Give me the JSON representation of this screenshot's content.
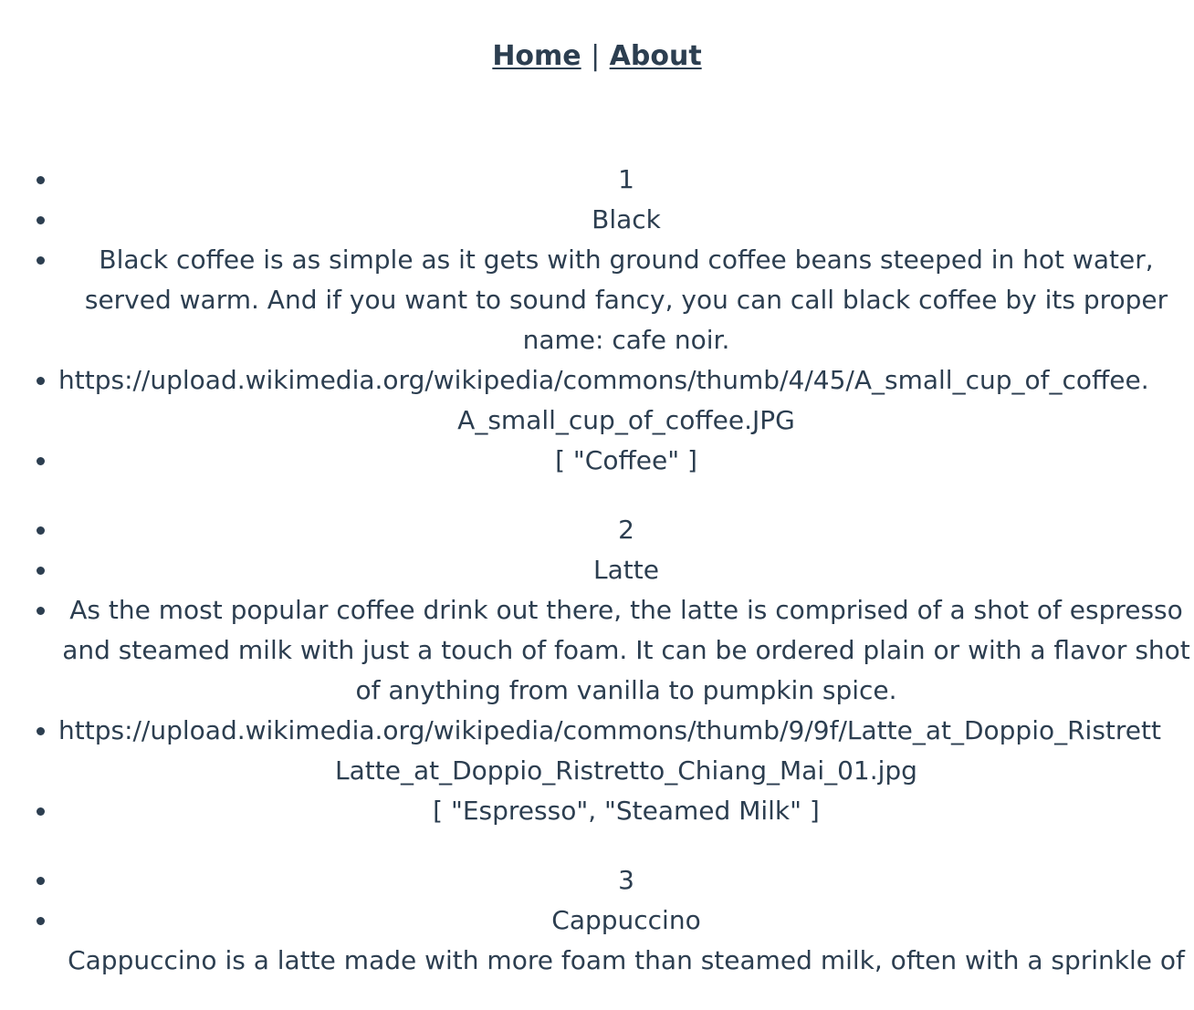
{
  "nav": {
    "home_label": "Home",
    "separator": "|",
    "about_label": "About"
  },
  "coffees": [
    {
      "id": "1",
      "title": "Black",
      "description": "Black coffee is as simple as it gets with ground coffee beans steeped in hot water, served warm. And if you want to sound fancy, you can call black coffee by its proper name: cafe noir.",
      "image_line1": "https://upload.wikimedia.org/wikipedia/commons/thumb/4/45/A_small_cup_of_coffee.",
      "image_line2": "A_small_cup_of_coffee.JPG",
      "ingredients": "[ \"Coffee\" ]"
    },
    {
      "id": "2",
      "title": "Latte",
      "description": "As the most popular coffee drink out there, the latte is comprised of a shot of espresso and steamed milk with just a touch of foam. It can be ordered plain or with a flavor shot of anything from vanilla to pumpkin spice.",
      "image_line1": "https://upload.wikimedia.org/wikipedia/commons/thumb/9/9f/Latte_at_Doppio_Ristrett",
      "image_line2": "Latte_at_Doppio_Ristretto_Chiang_Mai_01.jpg",
      "ingredients": "[ \"Espresso\", \"Steamed Milk\" ]"
    },
    {
      "id": "3",
      "title": "Cappuccino",
      "description": "Cappuccino is a latte made with more foam than steamed milk, often with a sprinkle of",
      "image_line1": "",
      "image_line2": "",
      "ingredients": ""
    }
  ]
}
